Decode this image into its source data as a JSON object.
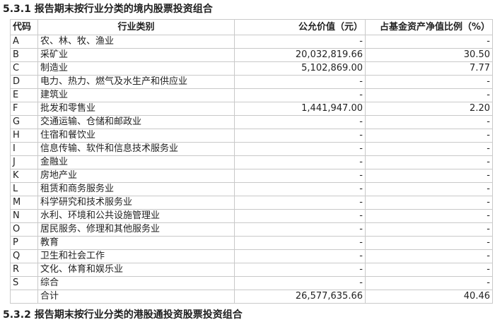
{
  "section_title": "5.3.1 报告期末按行业分类的境内股票投资组合",
  "next_section_title": "5.3.2 报告期末按行业分类的港股通投资股票投资组合",
  "table": {
    "headers": {
      "code": "代码",
      "industry": "行业类别",
      "fair_value": "公允价值（元）",
      "nav_ratio": "占基金资产净值比例（%）"
    },
    "rows": [
      {
        "code": "A",
        "industry": "农、林、牧、渔业",
        "fair_value": "-",
        "nav_ratio": "-"
      },
      {
        "code": "B",
        "industry": "采矿业",
        "fair_value": "20,032,819.66",
        "nav_ratio": "30.50"
      },
      {
        "code": "C",
        "industry": "制造业",
        "fair_value": "5,102,869.00",
        "nav_ratio": "7.77"
      },
      {
        "code": "D",
        "industry": "电力、热力、燃气及水生产和供应业",
        "fair_value": "-",
        "nav_ratio": "-"
      },
      {
        "code": "E",
        "industry": "建筑业",
        "fair_value": "-",
        "nav_ratio": "-"
      },
      {
        "code": "F",
        "industry": "批发和零售业",
        "fair_value": "1,441,947.00",
        "nav_ratio": "2.20"
      },
      {
        "code": "G",
        "industry": "交通运输、仓储和邮政业",
        "fair_value": "-",
        "nav_ratio": "-"
      },
      {
        "code": "H",
        "industry": "住宿和餐饮业",
        "fair_value": "-",
        "nav_ratio": "-"
      },
      {
        "code": "I",
        "industry": "信息传输、软件和信息技术服务业",
        "fair_value": "-",
        "nav_ratio": "-"
      },
      {
        "code": "J",
        "industry": "金融业",
        "fair_value": "-",
        "nav_ratio": "-"
      },
      {
        "code": "K",
        "industry": "房地产业",
        "fair_value": "-",
        "nav_ratio": "-"
      },
      {
        "code": "L",
        "industry": "租赁和商务服务业",
        "fair_value": "-",
        "nav_ratio": "-"
      },
      {
        "code": "M",
        "industry": "科学研究和技术服务业",
        "fair_value": "-",
        "nav_ratio": "-"
      },
      {
        "code": "N",
        "industry": "水利、环境和公共设施管理业",
        "fair_value": "-",
        "nav_ratio": "-"
      },
      {
        "code": "O",
        "industry": "居民服务、修理和其他服务业",
        "fair_value": "-",
        "nav_ratio": "-"
      },
      {
        "code": "P",
        "industry": "教育",
        "fair_value": "-",
        "nav_ratio": "-"
      },
      {
        "code": "Q",
        "industry": "卫生和社会工作",
        "fair_value": "-",
        "nav_ratio": "-"
      },
      {
        "code": "R",
        "industry": "文化、体育和娱乐业",
        "fair_value": "-",
        "nav_ratio": "-"
      },
      {
        "code": "S",
        "industry": "综合",
        "fair_value": "-",
        "nav_ratio": "-"
      },
      {
        "code": "",
        "industry": "合计",
        "fair_value": "26,577,635.66",
        "nav_ratio": "40.46"
      }
    ]
  }
}
